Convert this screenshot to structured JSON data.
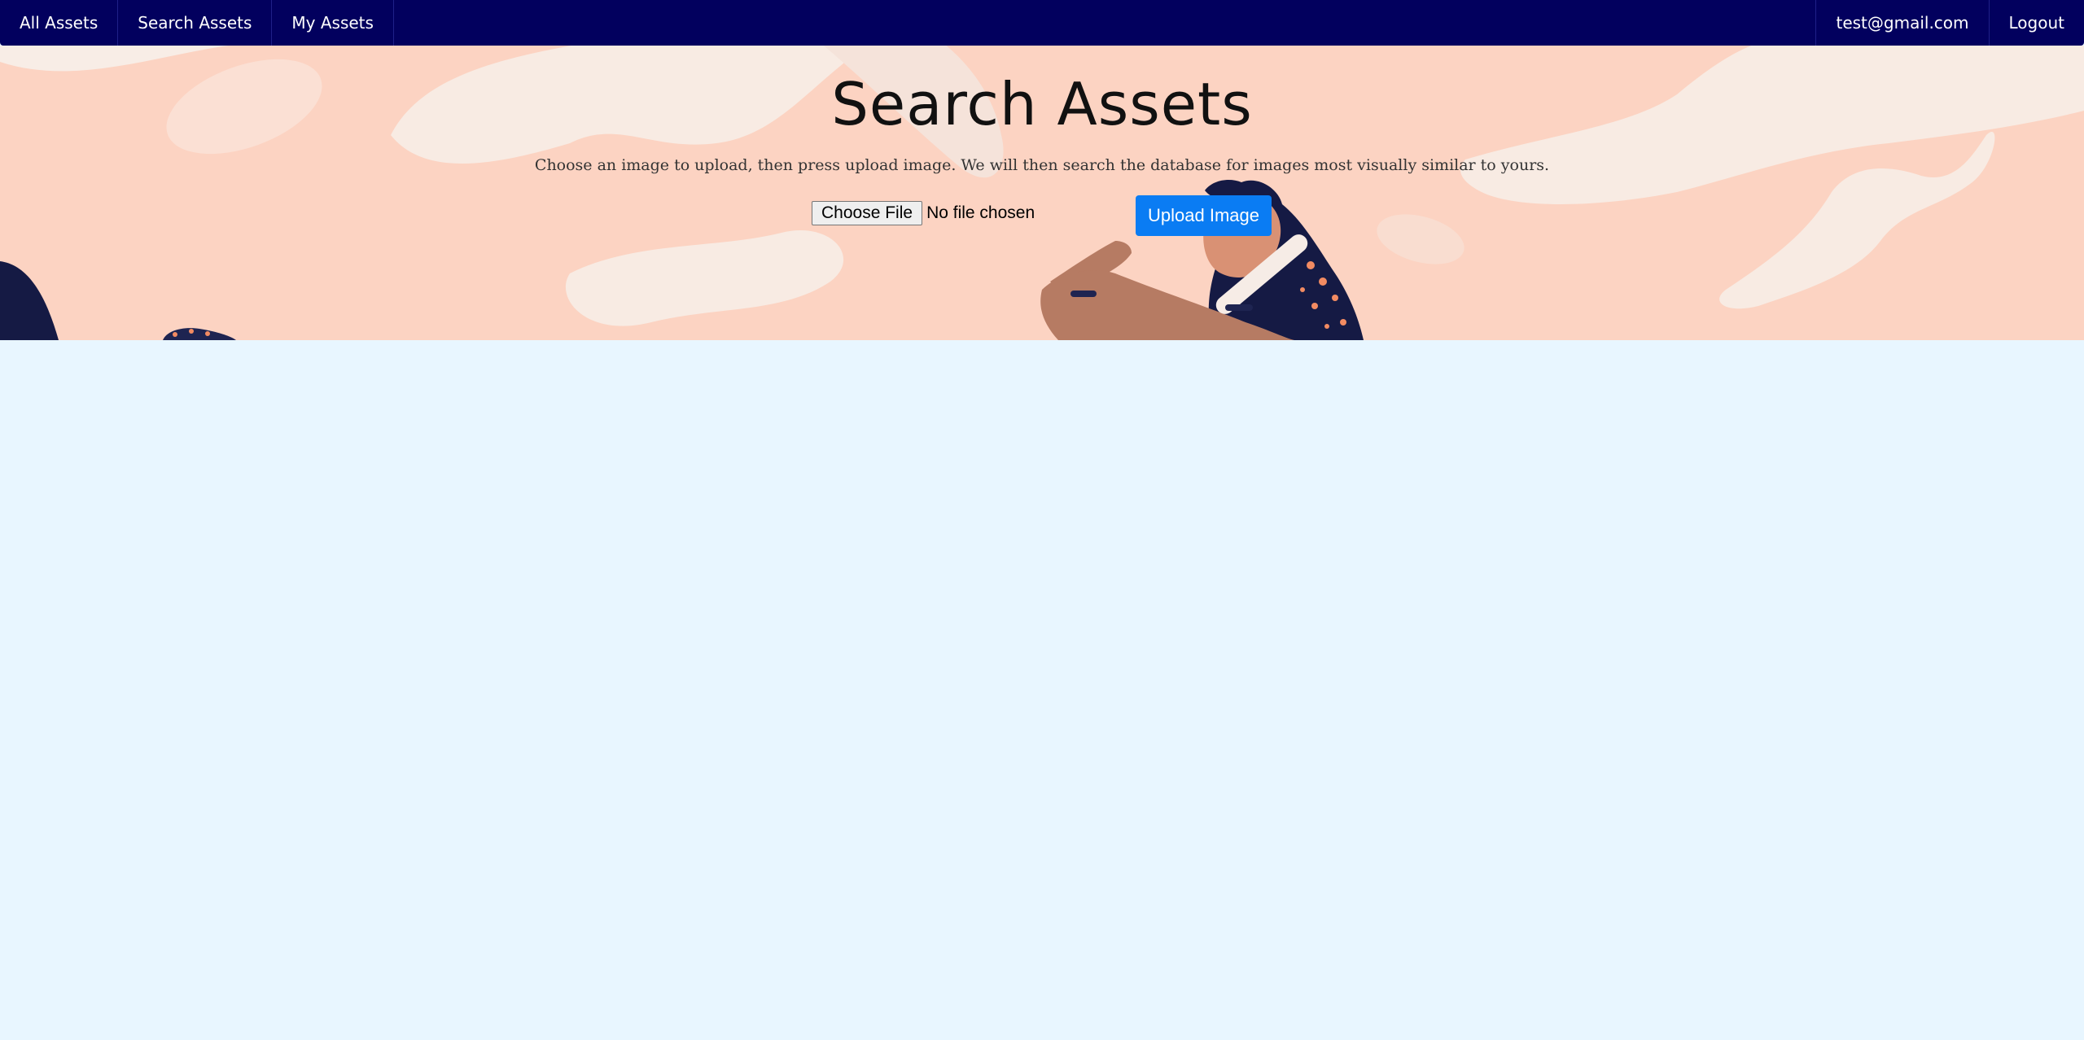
{
  "nav": {
    "left_items": [
      {
        "label": "All Assets"
      },
      {
        "label": "Search Assets"
      },
      {
        "label": "My Assets"
      }
    ],
    "user_email": "test@gmail.com",
    "logout_label": "Logout"
  },
  "hero": {
    "title": "Search Assets",
    "description": "Choose an image to upload, then press upload image. We will then search the database for images most visually similar to yours.",
    "choose_file_label": "Choose File",
    "file_status": "No file chosen",
    "upload_label": "Upload Image"
  },
  "colors": {
    "navbar": "#02005e",
    "hero_background": "#fcd3c2",
    "page_background": "#e8f6ff",
    "upload_button": "#0a7cf3"
  }
}
